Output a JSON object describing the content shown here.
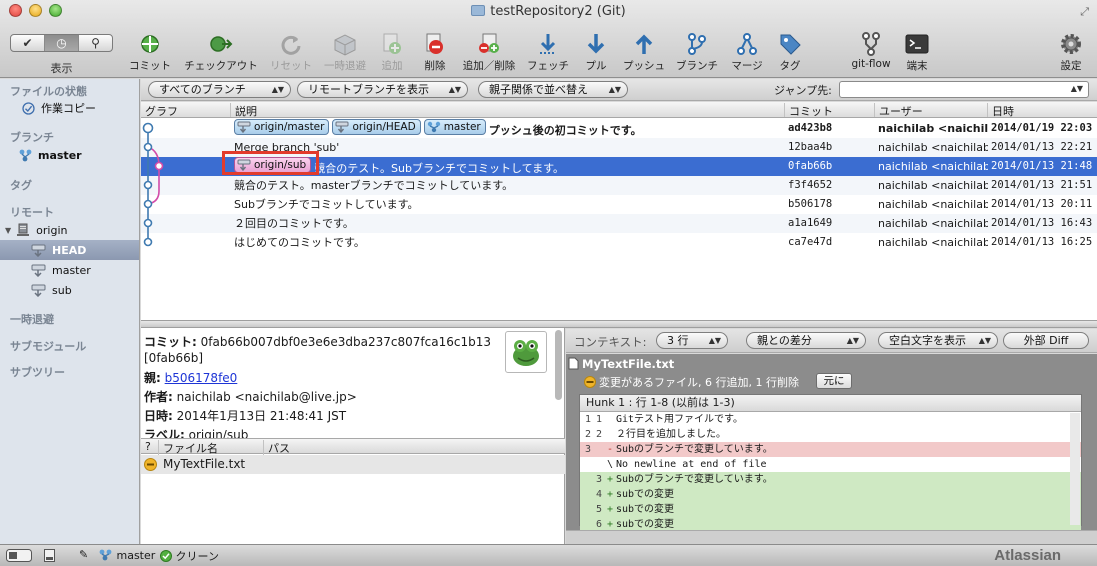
{
  "window": {
    "title": "testRepository2 (Git)"
  },
  "toolbar": {
    "view_label": "表示",
    "buttons": [
      {
        "label": "コミット",
        "icon": "commit-icon",
        "enabled": true
      },
      {
        "label": "チェックアウト",
        "icon": "checkout-icon",
        "enabled": true
      },
      {
        "label": "リセット",
        "icon": "reset-icon",
        "enabled": false
      },
      {
        "label": "一時退避",
        "icon": "stash-icon",
        "enabled": false
      },
      {
        "label": "追加",
        "icon": "add-icon",
        "enabled": false
      },
      {
        "label": "削除",
        "icon": "remove-icon",
        "enabled": true
      },
      {
        "label": "追加／削除",
        "icon": "add-remove-icon",
        "enabled": true
      },
      {
        "label": "フェッチ",
        "icon": "fetch-icon",
        "enabled": true
      },
      {
        "label": "プル",
        "icon": "pull-icon",
        "enabled": true
      },
      {
        "label": "プッシュ",
        "icon": "push-icon",
        "enabled": true
      },
      {
        "label": "ブランチ",
        "icon": "branch-icon",
        "enabled": true
      },
      {
        "label": "マージ",
        "icon": "merge-icon",
        "enabled": true
      },
      {
        "label": "タグ",
        "icon": "tag-icon",
        "enabled": true
      },
      {
        "label": "git-flow",
        "icon": "git-flow-icon",
        "enabled": true
      },
      {
        "label": "端末",
        "icon": "terminal-icon",
        "enabled": true
      },
      {
        "label": "設定",
        "icon": "settings-gear-icon",
        "enabled": true
      }
    ]
  },
  "sidebar": {
    "file_status_head": "ファイルの状態",
    "working_copy": "作業コピー",
    "branches_head": "ブランチ",
    "branch_master": "master",
    "tags_head": "タグ",
    "remotes_head": "リモート",
    "remote_origin": "origin",
    "remote_branches": [
      "HEAD",
      "master",
      "sub"
    ],
    "stashes_head": "一時退避",
    "submodules_head": "サブモジュール",
    "subtrees_head": "サブツリー"
  },
  "filter": {
    "branch_popup": "すべてのブランチ",
    "remote_popup": "リモートブランチを表示",
    "order_popup": "親子関係で並べ替え",
    "jump_label": "ジャンプ先:",
    "jump_value": ""
  },
  "commit_table": {
    "headers": {
      "graph": "グラフ",
      "description": "説明",
      "commit": "コミット",
      "user": "ユーザー",
      "date": "日時"
    },
    "rows": [
      {
        "tags": [
          "origin/master",
          "origin/HEAD",
          "master"
        ],
        "message": "プッシュ後の初コミットです。",
        "hash": "ad423b8",
        "user": "naichilab <naichilab@live.jp>",
        "date": "2014/01/19 22:03",
        "bold": true
      },
      {
        "tags": [],
        "message": "Merge branch 'sub'",
        "hash": "12baa4b",
        "user": "naichilab <naichilab@live.jp>",
        "date": "2014/01/13 22:21",
        "bold": false
      },
      {
        "tags": [
          "origin/sub"
        ],
        "message": "競合のテスト。Subブランチでコミットしてます。",
        "hash": "0fab66b",
        "user": "naichilab <naichilab@live.jp>",
        "date": "2014/01/13 21:48",
        "bold": false,
        "selected": true
      },
      {
        "tags": [],
        "message": "競合のテスト。masterブランチでコミットしています。",
        "hash": "f3f4652",
        "user": "naichilab <naichilab@live.jp>",
        "date": "2014/01/13 21:51",
        "bold": false
      },
      {
        "tags": [],
        "message": "Subブランチでコミットしています。",
        "hash": "b506178",
        "user": "naichilab <naichilab@live.jp>",
        "date": "2014/01/13 20:11",
        "bold": false
      },
      {
        "tags": [],
        "message": "２回目のコミットです。",
        "hash": "a1a1649",
        "user": "naichilab <naichilab@live.jp>",
        "date": "2014/01/13 16:43",
        "bold": false
      },
      {
        "tags": [],
        "message": "はじめてのコミットです。",
        "hash": "ca7e47d",
        "user": "naichilab <naichilab@live.jp>",
        "date": "2014/01/13 16:25",
        "bold": false
      }
    ]
  },
  "details": {
    "commit_label": "コミット:",
    "commit_full": "0fab66b007dbf0e3e6e3dba237c807fca16c1b13",
    "commit_short": "[0fab66b]",
    "parent_label": "親:",
    "parent_link": "b506178fe0",
    "author_label": "作者:",
    "author": "naichilab <naichilab@live.jp>",
    "date_label": "日時:",
    "date": "2014年1月13日 21:48:41 JST",
    "labels_label": "ラベル:",
    "labels": "origin/sub"
  },
  "files": {
    "head_q": "?",
    "head_name": "ファイル名",
    "head_path": "パス",
    "items": [
      "MyTextFile.txt"
    ]
  },
  "diff": {
    "context_label": "コンテキスト:",
    "context_popup": "3 行",
    "parent_popup": "親との差分",
    "whitespace_popup": "空白文字を表示",
    "external_button": "外部 Diff",
    "file_name": "MyTextFile.txt",
    "file_status": "変更があるファイル, 6 行追加, 1 行削除",
    "revert_button": "元に",
    "hunk_title": "Hunk 1 : 行 1-8 (以前は 1-3)",
    "lines": [
      {
        "n1": "1",
        "n2": "1",
        "sign": "",
        "text": "Gitテスト用ファイルです。",
        "kind": "ctx"
      },
      {
        "n1": "2",
        "n2": "2",
        "sign": "",
        "text": "２行目を追加しました。",
        "kind": "ctx"
      },
      {
        "n1": "3",
        "n2": "",
        "sign": "-",
        "text": "Subのブランチで変更しています。",
        "kind": "del"
      },
      {
        "n1": "",
        "n2": "",
        "sign": "\\",
        "text": " No newline at end of file",
        "kind": "ctx"
      },
      {
        "n1": "",
        "n2": "3",
        "sign": "+",
        "text": "Subのブランチで変更しています。",
        "kind": "add"
      },
      {
        "n1": "",
        "n2": "4",
        "sign": "+",
        "text": "subでの変更",
        "kind": "add"
      },
      {
        "n1": "",
        "n2": "5",
        "sign": "+",
        "text": "subでの変更",
        "kind": "add"
      },
      {
        "n1": "",
        "n2": "6",
        "sign": "+",
        "text": "subでの変更",
        "kind": "add"
      }
    ]
  },
  "statusbar": {
    "branch": "master",
    "state": "クリーン",
    "brand": "Atlassian"
  },
  "colors": {
    "selection": "#3b6dd1",
    "graph_blue": "#3f7ab0",
    "graph_pink": "#d24ba9",
    "highlight": "#e23b2c"
  }
}
